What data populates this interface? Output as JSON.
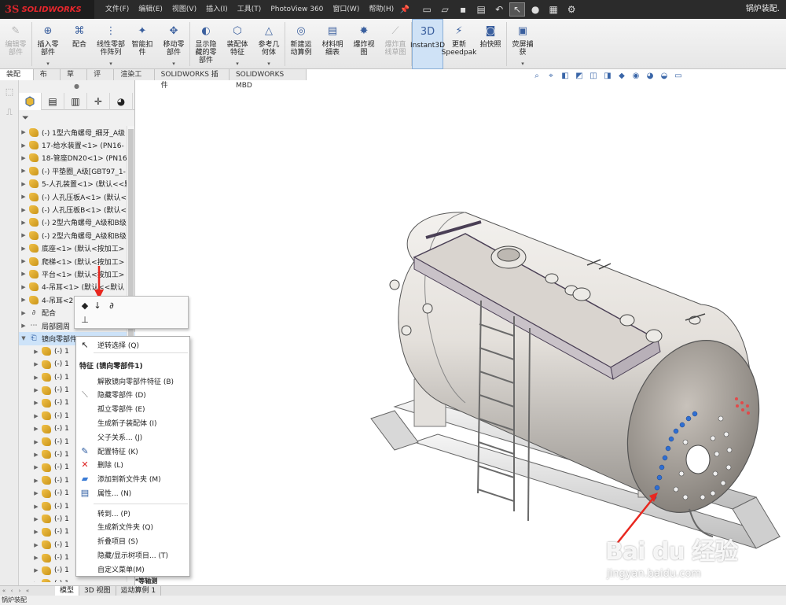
{
  "app": {
    "logo_mark": "3S",
    "logo_name": "SOLIDWORKS",
    "document_title": "锅炉装配."
  },
  "menu": [
    "文件(F)",
    "编辑(E)",
    "视图(V)",
    "插入(I)",
    "工具(T)",
    "PhotoView 360",
    "窗口(W)",
    "帮助(H)"
  ],
  "ribbon": {
    "buttons": [
      {
        "label": "编辑零\n部件",
        "icon": "edit-component-icon",
        "disabled": true
      },
      {
        "label": "插入零\n部件",
        "icon": "insert-component-icon",
        "dropdown": true
      },
      {
        "label": "配合",
        "icon": "mate-icon"
      },
      {
        "label": "线性零部\n件阵列",
        "icon": "linear-pattern-icon",
        "dropdown": true
      },
      {
        "label": "智能扣\n件",
        "icon": "smart-fasteners-icon"
      },
      {
        "label": "移动零\n部件",
        "icon": "move-component-icon",
        "dropdown": true
      },
      {
        "label": "显示隐\n藏的零\n部件",
        "icon": "show-hidden-icon"
      },
      {
        "label": "装配体\n特征",
        "icon": "assembly-features-icon",
        "dropdown": true
      },
      {
        "label": "参考几\n何体",
        "icon": "reference-geometry-icon",
        "dropdown": true
      },
      {
        "label": "新建运\n动算例",
        "icon": "new-motion-study-icon"
      },
      {
        "label": "材料明\n细表",
        "icon": "bom-icon"
      },
      {
        "label": "爆炸视\n图",
        "icon": "exploded-view-icon"
      },
      {
        "label": "爆炸直\n线草图",
        "icon": "explode-line-icon",
        "disabled": true
      },
      {
        "label": "Instant3D",
        "icon": "instant3d-icon",
        "active": true
      },
      {
        "label": "更新\nSpeedpak",
        "icon": "speedpak-icon"
      },
      {
        "label": "拍快照",
        "icon": "snapshot-icon"
      },
      {
        "label": "荧屏捕\n获",
        "icon": "screen-capture-icon",
        "dropdown": true
      }
    ]
  },
  "tabs": [
    "装配体",
    "布局",
    "草图",
    "评估",
    "渲染工具",
    "SOLIDWORKS 插件",
    "SOLIDWORKS MBD"
  ],
  "tree": {
    "items": [
      {
        "label": "(-) 1型六角螺母_细牙_A级",
        "type": "part"
      },
      {
        "label": "17-给水装置<1> (PN16-",
        "type": "part"
      },
      {
        "label": "18-管座DN20<1> (PN16",
        "type": "part"
      },
      {
        "label": "(-) 平垫圈_A级[GBT97_1-",
        "type": "part"
      },
      {
        "label": "5-人孔装置<1> (默认<<默",
        "type": "part"
      },
      {
        "label": "(-) 人孔压板A<1> (默认<",
        "type": "part"
      },
      {
        "label": "(-) 人孔压板B<1> (默认<",
        "type": "part"
      },
      {
        "label": "(-) 2型六角螺母_A级和B级",
        "type": "part"
      },
      {
        "label": "(-) 2型六角螺母_A级和B级",
        "type": "part"
      },
      {
        "label": "底座<1> (默认<按加工>",
        "type": "part"
      },
      {
        "label": "爬梯<1> (默认<按加工>",
        "type": "part"
      },
      {
        "label": "平台<1> (默认<按加工>",
        "type": "part"
      },
      {
        "label": "4-吊耳<1> (默认<<默认",
        "type": "part"
      },
      {
        "label": "4-吊耳<2",
        "type": "part"
      },
      {
        "label": "配合",
        "type": "mate"
      },
      {
        "label": "局部圆周",
        "type": "pattern"
      },
      {
        "label": "镜向零部件1",
        "type": "mirror",
        "selected": true
      },
      {
        "label": "(-) 1",
        "type": "part",
        "child": true
      },
      {
        "label": "(-) 1",
        "type": "part",
        "child": true
      },
      {
        "label": "(-) 1",
        "type": "part",
        "child": true
      },
      {
        "label": "(-) 1",
        "type": "part",
        "child": true
      },
      {
        "label": "(-) 1",
        "type": "part",
        "child": true
      },
      {
        "label": "(-) 1",
        "type": "part",
        "child": true
      },
      {
        "label": "(-) 1",
        "type": "part",
        "child": true
      },
      {
        "label": "(-) 1",
        "type": "part",
        "child": true
      },
      {
        "label": "(-) 1",
        "type": "part",
        "child": true
      },
      {
        "label": "(-) 1",
        "type": "part",
        "child": true
      },
      {
        "label": "(-) 1",
        "type": "part",
        "child": true
      },
      {
        "label": "(-) 1",
        "type": "part",
        "child": true
      },
      {
        "label": "(-) 1",
        "type": "part",
        "child": true
      },
      {
        "label": "(-) 1",
        "type": "part",
        "child": true
      },
      {
        "label": "(-) 1",
        "type": "part",
        "child": true
      },
      {
        "label": "(-) 1",
        "type": "part",
        "child": true
      },
      {
        "label": "(-) 1",
        "type": "part",
        "child": true
      },
      {
        "label": "(-) 1",
        "type": "part",
        "child": true
      },
      {
        "label": "(-) 1",
        "type": "part",
        "child": true
      }
    ]
  },
  "context_menu": {
    "top_item": "逆转选择 (Q)",
    "header": "特征 (镜向零部件1)",
    "group1": [
      {
        "label": "解散镜向零部件特征 (B)",
        "icon": ""
      },
      {
        "label": "隐藏零部件 (D)",
        "icon": "hide-icon"
      },
      {
        "label": "孤立零部件 (E)",
        "icon": ""
      },
      {
        "label": "生成新子装配体 (I)",
        "icon": ""
      },
      {
        "label": "父子关系... (J)",
        "icon": ""
      },
      {
        "label": "配置特征 (K)",
        "icon": "configure-icon"
      },
      {
        "label": "删除 (L)",
        "icon": "delete-icon"
      },
      {
        "label": "添加到新文件夹 (M)",
        "icon": "folder-icon"
      },
      {
        "label": "属性... (N)",
        "icon": "properties-icon"
      }
    ],
    "group2": [
      {
        "label": "转到... (P)"
      },
      {
        "label": "生成新文件夹 (Q)"
      },
      {
        "label": "折叠项目 (S)"
      },
      {
        "label": "隐藏/显示树项目... (T)"
      },
      {
        "label": "自定义菜单(M)"
      }
    ]
  },
  "bottom_tabs": [
    "模型",
    "3D 视图",
    "运动算例 1"
  ],
  "viewport_label": "*等轴测",
  "status_text": "锅炉装配",
  "watermark": {
    "brand": "Bai du 经验",
    "url": "jingyan.baidu.com"
  },
  "colors": {
    "accent_red": "#e8262c",
    "arrow_red": "#e8271f",
    "selection_blue": "#cde3f9",
    "hole_blue": "#2f6fd3"
  }
}
